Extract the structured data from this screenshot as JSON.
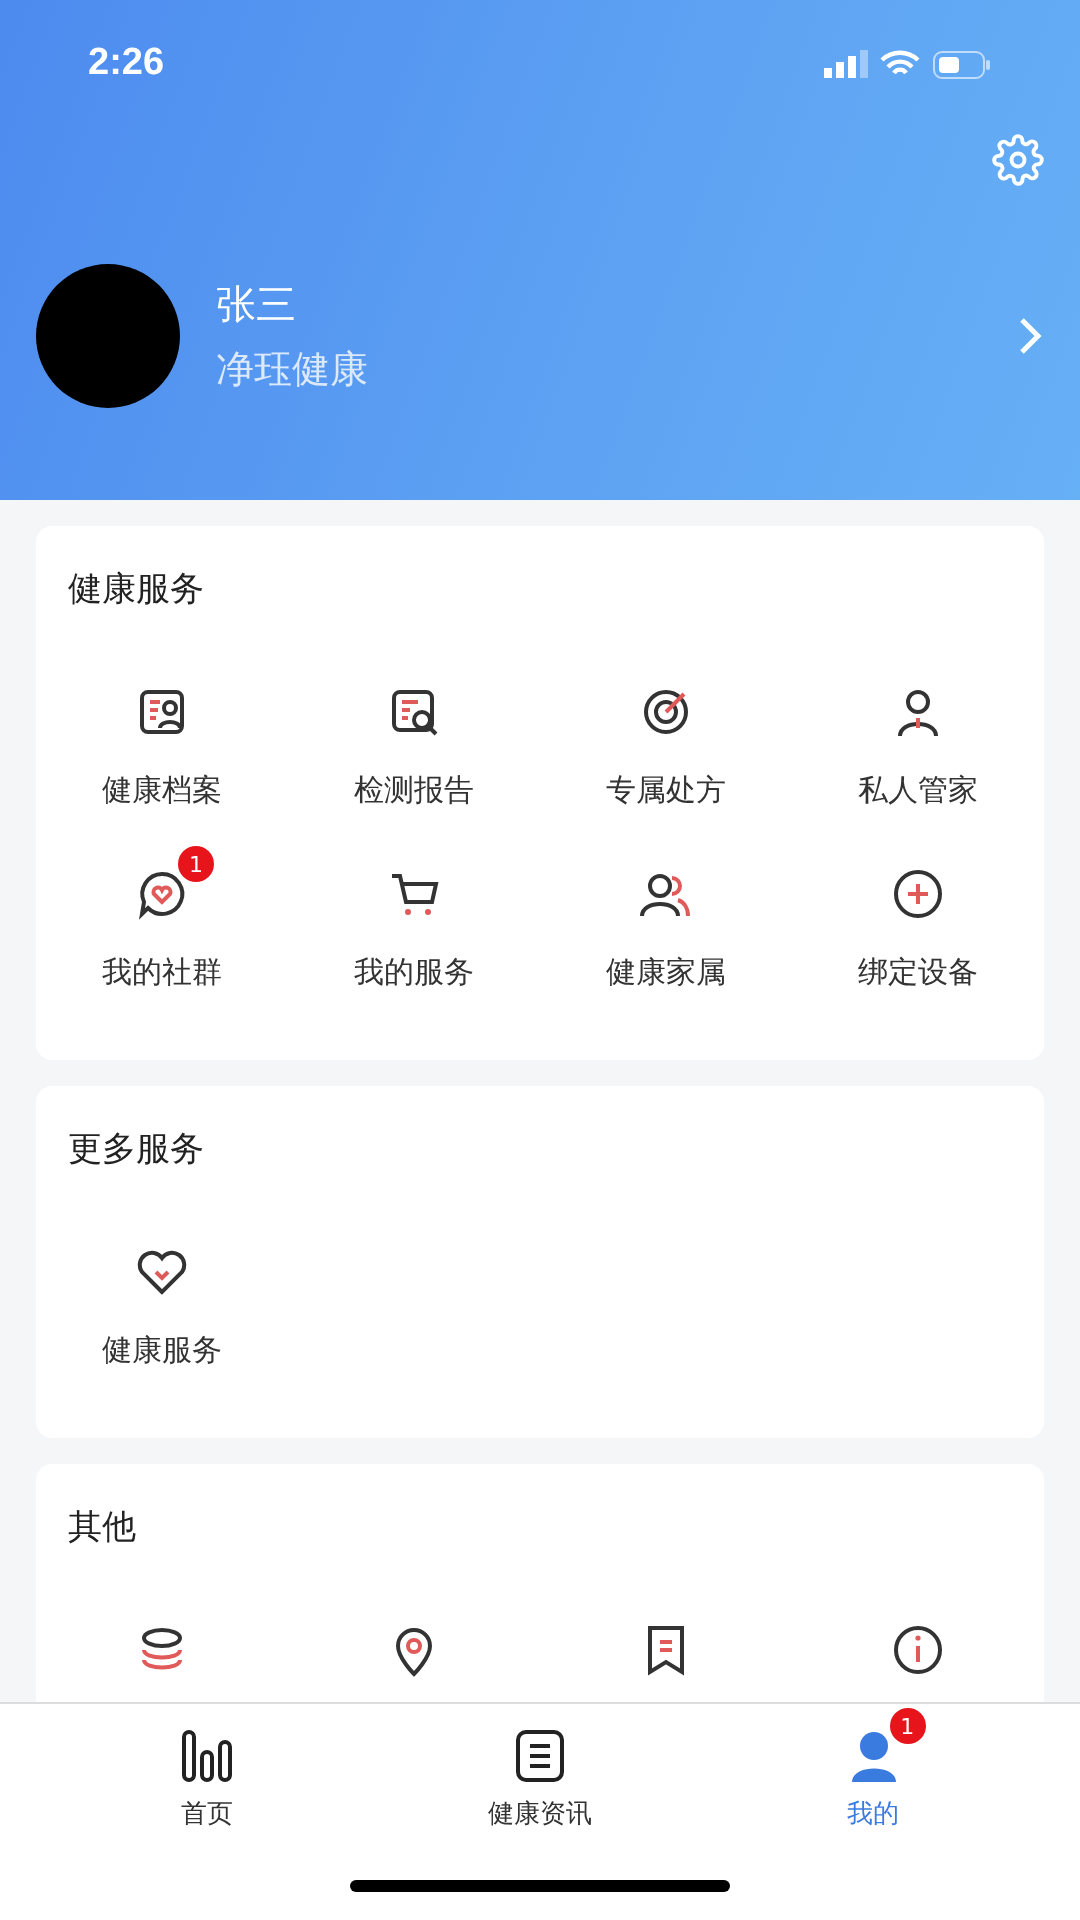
{
  "status_bar": {
    "time": "2:26"
  },
  "profile": {
    "name": "张三",
    "subtitle": "净珏健康"
  },
  "sections": [
    {
      "title": "健康服务",
      "items": [
        {
          "label": "健康档案"
        },
        {
          "label": "检测报告"
        },
        {
          "label": "专属处方"
        },
        {
          "label": "私人管家"
        },
        {
          "label": "我的社群",
          "badge": "1"
        },
        {
          "label": "我的服务"
        },
        {
          "label": "健康家属"
        },
        {
          "label": "绑定设备"
        }
      ]
    },
    {
      "title": "更多服务",
      "items": [
        {
          "label": "健康服务"
        }
      ]
    },
    {
      "title": "其他"
    }
  ],
  "tab_bar": [
    {
      "label": "首页",
      "selected": false
    },
    {
      "label": "健康资讯",
      "selected": false
    },
    {
      "label": "我的",
      "selected": true,
      "badge": "1"
    }
  ]
}
